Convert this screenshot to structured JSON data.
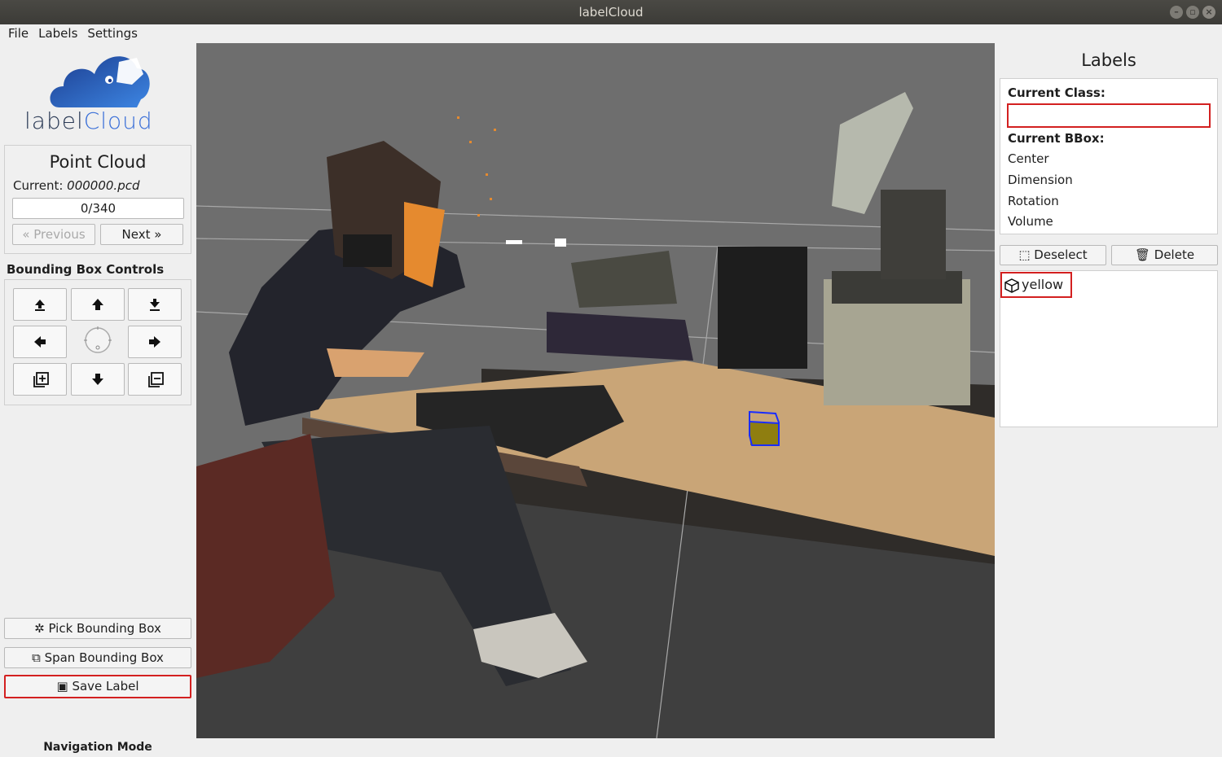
{
  "window": {
    "title": "labelCloud"
  },
  "menu": [
    "File",
    "Labels",
    "Settings"
  ],
  "logo": {
    "part1": "label",
    "part2": "Cloud"
  },
  "point_cloud": {
    "title": "Point Cloud",
    "current_prefix": "Current: ",
    "current_file": "000000.pcd",
    "counter": "0/340",
    "previous_label": "« Previous",
    "next_label": "Next »"
  },
  "bbox_controls": {
    "title": "Bounding Box Controls",
    "buttons": [
      "move-up-z-icon",
      "move-forward-icon",
      "move-down-z-icon",
      "move-left-icon",
      "rotate-dial-icon",
      "move-right-icon",
      "increase-size-icon",
      "move-backward-icon",
      "decrease-size-icon"
    ]
  },
  "actions": {
    "pick": "Pick Bounding Box",
    "span": "Span Bounding Box",
    "save": "Save Label"
  },
  "status": {
    "mode": "Navigation Mode"
  },
  "labels_panel": {
    "title": "Labels",
    "current_class_label": "Current Class:",
    "current_class_value": "",
    "current_bbox_label": "Current BBox:",
    "fields": [
      "Center",
      "Dimension",
      "Rotation",
      "Volume"
    ],
    "deselect": "Deselect",
    "delete": "Delete",
    "items": [
      "yellow"
    ]
  },
  "colors": {
    "highlight": "#d32020",
    "bbox": "#1a2dff"
  }
}
